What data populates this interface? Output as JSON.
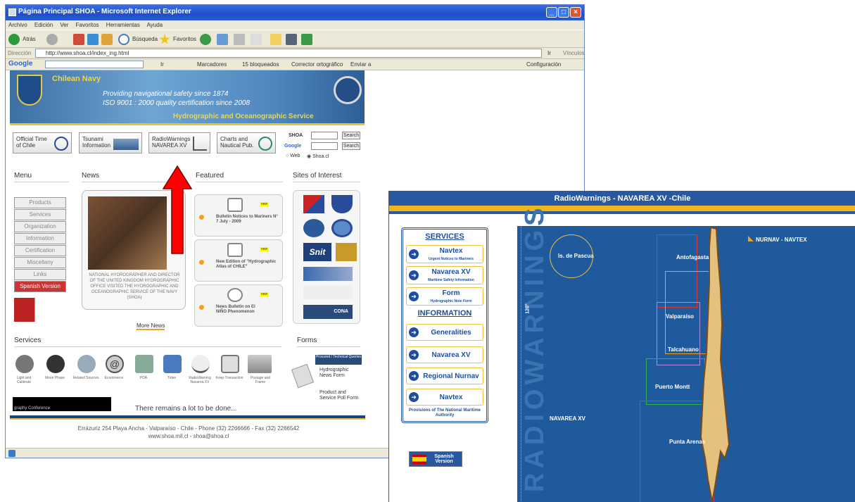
{
  "browser": {
    "title": "Página Principal SHOA - Microsoft Internet Explorer",
    "menu": [
      "Archivo",
      "Edición",
      "Ver",
      "Favoritos",
      "Herramientas",
      "Ayuda"
    ],
    "toolbar": {
      "back": "Atrás",
      "search": "Búsqueda",
      "favorites": "Favoritos"
    },
    "address_label": "Dirección",
    "address": "http://www.shoa.cl/index_ing.html",
    "go": "Ir",
    "links": "Vínculos",
    "google": {
      "logo": "Google",
      "go": "Ir",
      "bookmarks": "Marcadores",
      "blocked": "15 bloqueados",
      "spell": "Corrector ortográfico",
      "send": "Enviar a",
      "settings": "Configuración"
    }
  },
  "site": {
    "banner": {
      "navy": "Chilean Navy",
      "line1": "Providing navigational safety since 1874",
      "line2": "ISO 9001 : 2000 quality certification since 2008",
      "service": "Hydrographic and Oceanographic Service"
    },
    "quick": [
      {
        "label1": "Official Time",
        "label2": "of Chile"
      },
      {
        "label1": "Tsunami",
        "label2": "Information"
      },
      {
        "label1": "RadioWarnings",
        "label2": "NAVAREA XV"
      },
      {
        "label1": "Charts and",
        "label2": "Nautical Pub."
      }
    ],
    "search": {
      "shoa": "SHOA",
      "google": "Google",
      "button": "Search",
      "web": "Web",
      "site": "Shoa.cl"
    },
    "headers": {
      "menu": "Menu",
      "news": "News",
      "featured": "Featured",
      "sites": "Sites of Interest",
      "services": "Services",
      "forms": "Forms"
    },
    "menu": [
      "Products",
      "Services",
      "Organization",
      "Information",
      "Certification",
      "Miscellany",
      "Links",
      "Spanish Version"
    ],
    "news_caption": "NATIONAL HYDROGRAPHER AND DIRECTOR OF THE UNITED KINGDOM HYDROGRAPHIC OFFICE VISITED THE HYDROGRAPHIC AND OCEANOGRAPHIC SERVICE OF THE NAVY (SHOA)",
    "more_news": "More News",
    "featured": [
      {
        "text": "Bulletin Notices to Mariners N° 7 July - 2009"
      },
      {
        "text": "New Edition of \"Hydrographic Atlas of CHILE\""
      },
      {
        "text": "News Bulletin on El NIÑO Phenomenon"
      }
    ],
    "new_badge": "new",
    "sites": {
      "snit": "Snit",
      "cona": "CONA"
    },
    "services": [
      "Light and Calibrate",
      "Moon Phase",
      "Related Sources",
      "Ecommerce",
      "PDA",
      "Tides",
      "RadioWarning Navarea XV",
      "Keep Transaction",
      "Postage and Frame"
    ],
    "forms": {
      "header": "Procured / Technical Queries",
      "item1": "Hydrographic News Form",
      "item2": "Product and Service Poll Form"
    },
    "conference": "graphy Conference",
    "motto": "There remains a lot to be done...",
    "footer1": "Errázuriz 254 Playa Ancha - Valparaíso - Chile - Phone (32) 2266666 - Fax (32) 2266542",
    "footer2": "www.shoa.mil.cl - shoa@shoa.cl"
  },
  "radiowarnings": {
    "title": "RadioWarnings - NAVAREA XV -Chile",
    "services_header": "SERVICES",
    "services": [
      {
        "title": "Navtex",
        "subtitle": "Urgent Notices to Mariners"
      },
      {
        "title": "Navarea XV",
        "subtitle": "Maritime Safety Information"
      },
      {
        "title": "Form",
        "subtitle": "Hydrographic Note Form"
      }
    ],
    "info_header": "INFORMATION",
    "info": [
      "Generalities",
      "Navarea XV",
      "Regional Nurnav",
      "Navtex"
    ],
    "provisions": "Provisions of The National Maritime Authority",
    "spanish": "Spanish Version",
    "map": {
      "watermark": "RADIOWARNINGS",
      "meridian": "120°",
      "island": "Is. de Pascua",
      "legend": "NURNAV - NAVTEX",
      "navarea": "NAVAREA XV",
      "regions": [
        "Antofagasta",
        "Valparaíso",
        "Talcahuano",
        "Puerto Montt",
        "Punta Arenas"
      ],
      "colors": [
        "#d63a3a",
        "#f0a21a",
        "#b18be0",
        "#2fb34a",
        "#b43aa3"
      ]
    }
  }
}
